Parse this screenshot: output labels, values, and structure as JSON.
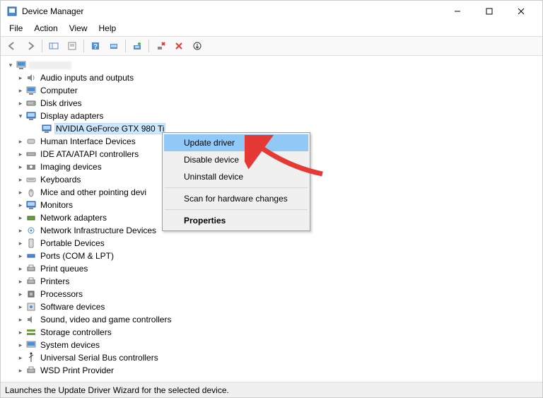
{
  "window": {
    "title": "Device Manager"
  },
  "menubar": {
    "file": "File",
    "action": "Action",
    "view": "View",
    "help": "Help"
  },
  "tree": {
    "root_name": "",
    "nodes": [
      {
        "label": "Audio inputs and outputs",
        "expanded": false
      },
      {
        "label": "Computer",
        "expanded": false
      },
      {
        "label": "Disk drives",
        "expanded": false
      },
      {
        "label": "Display adapters",
        "expanded": true,
        "children": [
          {
            "label": "NVIDIA GeForce GTX 980 Ti",
            "selected": true
          }
        ]
      },
      {
        "label": "Human Interface Devices",
        "expanded": false
      },
      {
        "label": "IDE ATA/ATAPI controllers",
        "expanded": false
      },
      {
        "label": "Imaging devices",
        "expanded": false
      },
      {
        "label": "Keyboards",
        "expanded": false
      },
      {
        "label": "Mice and other pointing devi",
        "expanded": false
      },
      {
        "label": "Monitors",
        "expanded": false
      },
      {
        "label": "Network adapters",
        "expanded": false
      },
      {
        "label": "Network Infrastructure Devices",
        "expanded": false
      },
      {
        "label": "Portable Devices",
        "expanded": false
      },
      {
        "label": "Ports (COM & LPT)",
        "expanded": false
      },
      {
        "label": "Print queues",
        "expanded": false
      },
      {
        "label": "Printers",
        "expanded": false
      },
      {
        "label": "Processors",
        "expanded": false
      },
      {
        "label": "Software devices",
        "expanded": false
      },
      {
        "label": "Sound, video and game controllers",
        "expanded": false
      },
      {
        "label": "Storage controllers",
        "expanded": false
      },
      {
        "label": "System devices",
        "expanded": false
      },
      {
        "label": "Universal Serial Bus controllers",
        "expanded": false
      },
      {
        "label": "WSD Print Provider",
        "expanded": false
      }
    ]
  },
  "context_menu": {
    "update_driver": "Update driver",
    "disable_device": "Disable device",
    "uninstall_device": "Uninstall device",
    "scan_hardware": "Scan for hardware changes",
    "properties": "Properties"
  },
  "statusbar": {
    "text": "Launches the Update Driver Wizard for the selected device."
  }
}
